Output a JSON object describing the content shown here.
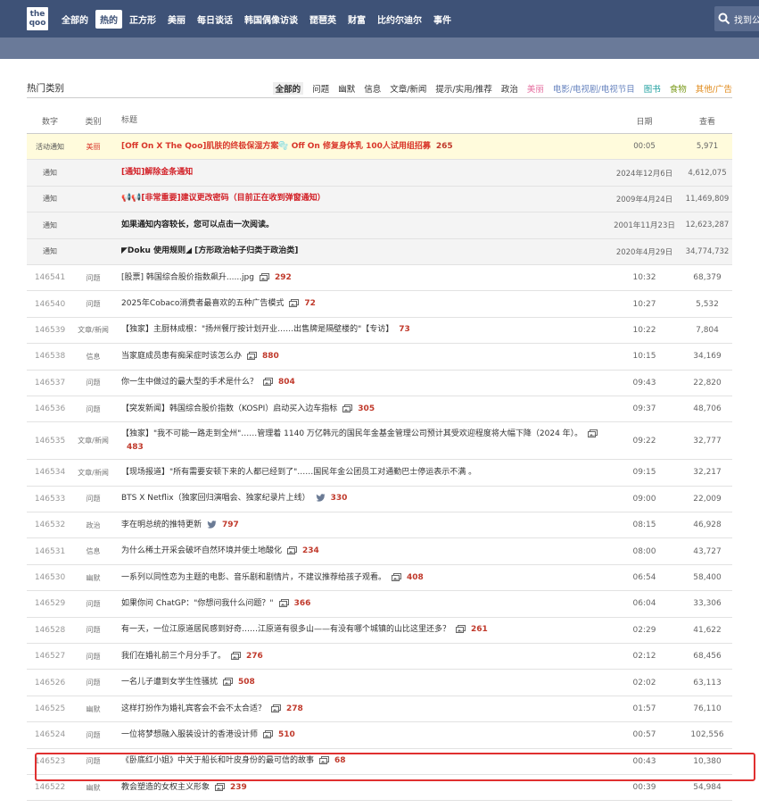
{
  "nav": {
    "logo": "the qoo",
    "items": [
      "全部的",
      "热的",
      "正方形",
      "美丽",
      "每日谈话",
      "韩国偶像访谈",
      "琵琶英",
      "财富",
      "比约尔迪尔",
      "事件"
    ],
    "active_index": 1,
    "search_placeholder": "找到公"
  },
  "category_bar": {
    "title": "热门类别",
    "categories": [
      {
        "label": "全部的",
        "color": "#333333",
        "active": true
      },
      {
        "label": "问题",
        "color": "#333333"
      },
      {
        "label": "幽默",
        "color": "#333333"
      },
      {
        "label": "信息",
        "color": "#333333"
      },
      {
        "label": "文章/新闻",
        "color": "#333333"
      },
      {
        "label": "提示/实用/推荐",
        "color": "#333333"
      },
      {
        "label": "政治",
        "color": "#333333"
      },
      {
        "label": "美丽",
        "color": "#e66fa0"
      },
      {
        "label": "电影/电视剧/电视节目",
        "color": "#6a86c0"
      },
      {
        "label": "图书",
        "color": "#20a0a0"
      },
      {
        "label": "食物",
        "color": "#7a9a1a"
      },
      {
        "label": "其他/广告",
        "color": "#e08a1a"
      }
    ]
  },
  "table": {
    "headers": {
      "num": "数字",
      "cat": "类别",
      "title": "标题",
      "date": "日期",
      "views": "查看"
    },
    "notices": [
      {
        "num": "活动通知",
        "cat": "美丽",
        "title": "[Off On X The Qoo]肌肤的终极保湿方案🫧 Off On 修复身体乳 100人试用组招募",
        "comments": "265",
        "date": "00:05",
        "views": "5,971",
        "style": "promo"
      },
      {
        "num": "通知",
        "cat": "",
        "title": "[通知]解除金条通知",
        "comments": "",
        "date": "2024年12月6日",
        "views": "4,612,075",
        "style": "red"
      },
      {
        "num": "通知",
        "cat": "",
        "title": "📢📢[非常重要]建议更改密码（目前正在收到弹窗通知）",
        "comments": "",
        "date": "2009年4月24日",
        "views": "11,469,809",
        "style": "red"
      },
      {
        "num": "通知",
        "cat": "",
        "title": "如果通知内容较长，您可以点击一次阅读。",
        "comments": "",
        "date": "2001年11月23日",
        "views": "12,623,287",
        "style": "black"
      },
      {
        "num": "通知",
        "cat": "",
        "title": "◤Doku 使用规则◢ [方形政治帖子归类于政治类]",
        "comments": "",
        "date": "2020年4月29日",
        "views": "34,774,732",
        "style": "black"
      }
    ],
    "rows": [
      {
        "num": "146541",
        "cat": "问题",
        "title": "[股票] 韩国综合股价指数飙升......jpg",
        "icon": "image",
        "comments": "292",
        "date": "10:32",
        "views": "68,379"
      },
      {
        "num": "146540",
        "cat": "问题",
        "title": "2025年Cobaco消费者最喜欢的五种广告模式",
        "icon": "image",
        "comments": "72",
        "date": "10:27",
        "views": "5,532"
      },
      {
        "num": "146539",
        "cat": "文章/新闻",
        "title": "【独家】主厨林成根：\"扬州餐厅按计划开业……出售牌是隔壁楼的\"【专访】",
        "icon": "",
        "comments": "73",
        "date": "10:22",
        "views": "7,804"
      },
      {
        "num": "146538",
        "cat": "信息",
        "title": "当家庭成员患有痴呆症时该怎么办",
        "icon": "image",
        "comments": "880",
        "date": "10:15",
        "views": "34,169"
      },
      {
        "num": "146537",
        "cat": "问题",
        "title": "你一生中做过的最大型的手术是什么？",
        "icon": "image",
        "comments": "804",
        "date": "09:43",
        "views": "22,820"
      },
      {
        "num": "146536",
        "cat": "问题",
        "title": "【突发新闻】韩国综合股价指数（KOSPI）启动买入边车指标",
        "icon": "image",
        "comments": "305",
        "date": "09:37",
        "views": "48,706"
      },
      {
        "num": "146535",
        "cat": "文章/新闻",
        "title": "【独家】\"我不可能一路走到全州\"……管理着 1140 万亿韩元的国民年金基金管理公司预计其受欢迎程度将大幅下降（2024 年）。",
        "icon": "image",
        "comments": "483",
        "date": "09:22",
        "views": "32,777",
        "tall": true
      },
      {
        "num": "146534",
        "cat": "文章/新闻",
        "title": "【现场报道】\"所有需要安顿下来的人都已经到了\"……国民年金公团员工对通勤巴士停运表示不满 。",
        "icon": "",
        "comments": "",
        "date": "09:15",
        "views": "32,217"
      },
      {
        "num": "146533",
        "cat": "问题",
        "title": "BTS X Netflix（独家回归演唱会、独家纪录片上线）",
        "icon": "twitter",
        "comments": "330",
        "date": "09:00",
        "views": "22,009"
      },
      {
        "num": "146532",
        "cat": "政治",
        "title": "李在明总统的推特更新",
        "icon": "twitter",
        "comments": "797",
        "date": "08:15",
        "views": "46,928"
      },
      {
        "num": "146531",
        "cat": "信息",
        "title": "为什么稀土开采会破坏自然环境并使土地酸化",
        "icon": "image",
        "comments": "234",
        "date": "08:00",
        "views": "43,727"
      },
      {
        "num": "146530",
        "cat": "幽默",
        "title": "一系列以同性恋为主题的电影、音乐剧和剧情片，不建议推荐给孩子观看。",
        "icon": "image",
        "comments": "408",
        "date": "06:54",
        "views": "58,400"
      },
      {
        "num": "146529",
        "cat": "问题",
        "title": "如果你问 ChatGP：\"你想问我什么问题？\"",
        "icon": "image",
        "comments": "366",
        "date": "06:04",
        "views": "33,306"
      },
      {
        "num": "146528",
        "cat": "问题",
        "title": "有一天，一位江原道居民感到好奇……江原道有很多山——有没有哪个城镇的山比这里还多？",
        "icon": "image",
        "comments": "261",
        "date": "02:29",
        "views": "41,622"
      },
      {
        "num": "146527",
        "cat": "问题",
        "title": "我们在婚礼前三个月分手了。",
        "icon": "image",
        "comments": "276",
        "date": "02:12",
        "views": "68,456"
      },
      {
        "num": "146526",
        "cat": "问题",
        "title": "一名儿子遭到女学生性骚扰",
        "icon": "image",
        "comments": "508",
        "date": "02:02",
        "views": "63,113"
      },
      {
        "num": "146525",
        "cat": "幽默",
        "title": "这样打扮作为婚礼宾客会不会不太合适？",
        "icon": "image",
        "comments": "278",
        "date": "01:57",
        "views": "76,110"
      },
      {
        "num": "146524",
        "cat": "问题",
        "title": "一位将梦想融入服装设计的香港设计师",
        "icon": "image",
        "comments": "510",
        "date": "00:57",
        "views": "102,556"
      },
      {
        "num": "146523",
        "cat": "问题",
        "title": "《卧底红小姐》中关于船长和叶皮身份的最可信的故事",
        "icon": "image",
        "comments": "68",
        "date": "00:43",
        "views": "10,380"
      },
      {
        "num": "146522",
        "cat": "幽默",
        "title": "教会塑造的女权主义形象",
        "icon": "image",
        "comments": "239",
        "date": "00:39",
        "views": "54,984"
      }
    ]
  },
  "highlight_color": "#e03030"
}
